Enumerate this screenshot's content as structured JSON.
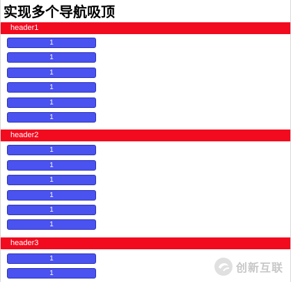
{
  "page": {
    "title": "实现多个导航吸顶"
  },
  "sections": [
    {
      "header": "header1",
      "items": [
        "1",
        "1",
        "1",
        "1",
        "1",
        "1"
      ]
    },
    {
      "header": "header2",
      "items": [
        "1",
        "1",
        "1",
        "1",
        "1",
        "1"
      ]
    },
    {
      "header": "header3",
      "items": [
        "1",
        "1"
      ]
    }
  ],
  "watermark": {
    "text": "创新互联",
    "icon": "chuangxin-logo-icon"
  },
  "colors": {
    "header_bg": "#f20a1e",
    "button_bg": "#4a52f0",
    "button_border": "#2d34b8",
    "text_on_color": "#ffffff"
  }
}
